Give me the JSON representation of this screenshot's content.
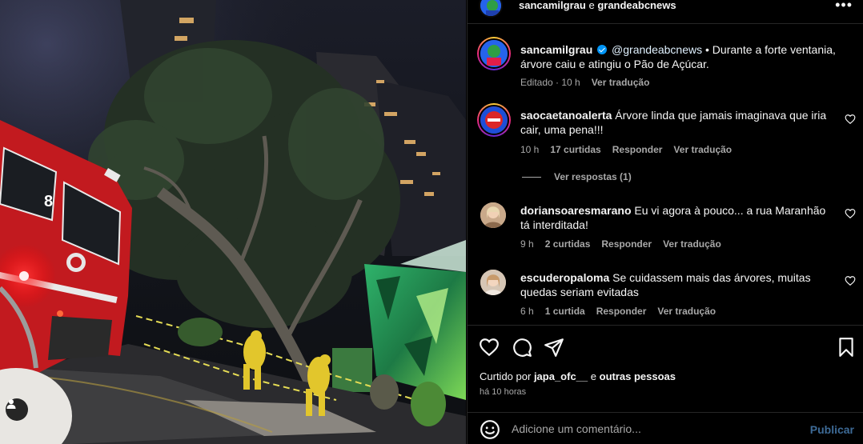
{
  "header": {
    "author": "sancamilgrau",
    "joiner": "e",
    "coauthor": "grandeabcnews"
  },
  "caption": {
    "username": "sancamilgrau",
    "mention": "@grandeabcnews",
    "text": "• Durante a forte ventania, árvore caiu e atingiu o Pão de Açúcar.",
    "edited": "Editado · 10 h",
    "translate": "Ver tradução"
  },
  "comments": [
    {
      "username": "saocaetanoalerta",
      "text": "Árvore linda que jamais imaginava que iria cair, uma pena!!!",
      "time": "10 h",
      "likes": "17 curtidas",
      "reply": "Responder",
      "translate": "Ver tradução"
    },
    {
      "username": "doriansoaresmarano",
      "text": "Eu vi agora à pouco... a rua Maranhão tá interditada!",
      "time": "9 h",
      "likes": "2 curtidas",
      "reply": "Responder",
      "translate": "Ver tradução"
    },
    {
      "username": "escuderopaloma",
      "text": "Se cuidassem mais das árvores, muitas quedas seriam evitadas",
      "time": "6 h",
      "likes": "1 curtida",
      "reply": "Responder",
      "translate": "Ver tradução"
    }
  ],
  "view_replies": "Ver respostas (1)",
  "liked_by": {
    "prefix": "Curtido por",
    "user": "japa_ofc__",
    "joiner": "e",
    "others": "outras pessoas"
  },
  "posted_ago": "há 10 horas",
  "comment_input": {
    "placeholder": "Adicione um comentário...",
    "submit": "Publicar"
  },
  "photo": {
    "truck_number": "8"
  },
  "colors": {
    "background": "#000000",
    "text": "#f5f5f5",
    "muted": "#a8a8a8",
    "verified": "#0095f6",
    "publish_disabled": "#3d6a96"
  },
  "icons": [
    "more-options-icon",
    "verified-icon",
    "heart-icon",
    "comment-icon",
    "share-icon",
    "save-icon",
    "emoji-icon",
    "user-tag-icon"
  ]
}
